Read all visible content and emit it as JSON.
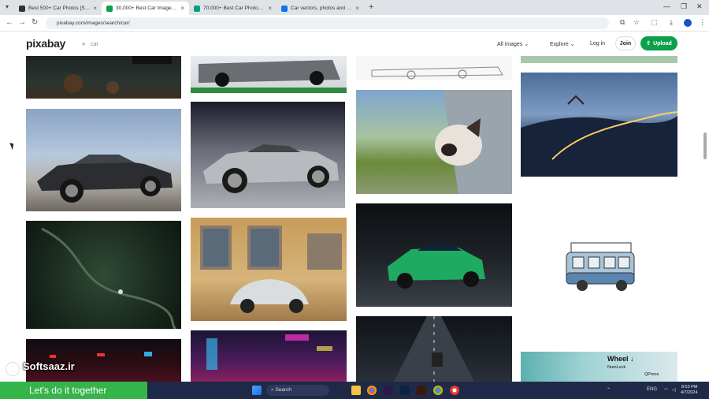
{
  "tabs": [
    {
      "title": "Best 500+ Car Photos [Spectac...",
      "color": "#333333",
      "active": false
    },
    {
      "title": "30,000+ Best Car Images, Pictu...",
      "color": "#0ca04c",
      "active": true
    },
    {
      "title": "70,000+ Best Car Photos · 100...",
      "color": "#05a081",
      "active": false
    },
    {
      "title": "Car vectors, photos and PSD fil...",
      "color": "#1273eb",
      "active": false
    }
  ],
  "url": "pixabay.com/images/search/car/",
  "header": {
    "logo": "pixabay",
    "search_value": "car",
    "all_images": "All images",
    "explore": "Explore",
    "login": "Log in",
    "join": "Join",
    "upload": "Upload"
  },
  "overlay": {
    "watermark": "Softsaaz.ir",
    "tagline": "Let's do it together",
    "wheel": "Wheel ↓",
    "numlock": "NumLock",
    "qpress": "QPress"
  },
  "taskbar": {
    "search": "Search",
    "language": "ENG",
    "time": "8:53 PM",
    "date": "4/7/2024"
  },
  "colors": {
    "brand": "#0ca04c",
    "taskbar": "#1f2a48",
    "tagline": "#35b44a"
  }
}
